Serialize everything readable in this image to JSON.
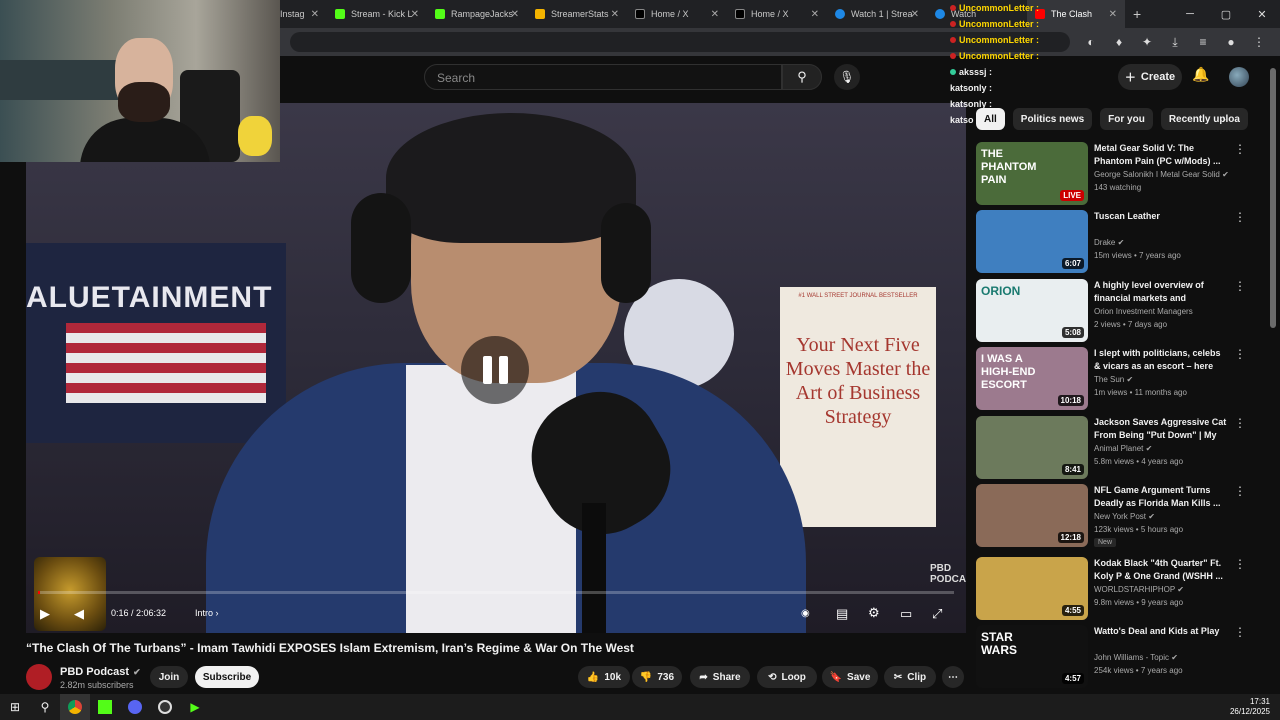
{
  "browser": {
    "tabs": [
      {
        "label": "Instag",
        "color": "#c13584"
      },
      {
        "label": "Stream - Kick L",
        "color": "#53fc18"
      },
      {
        "label": "RampageJacks",
        "color": "#53fc18"
      },
      {
        "label": "StreamerStats",
        "color": "#f4b400"
      },
      {
        "label": "Home / X",
        "color": "#ffffff"
      },
      {
        "label": "Home / X",
        "color": "#ffffff"
      },
      {
        "label": "Watch 1 | Strea",
        "color": "#1e88e5"
      },
      {
        "label": "Watch",
        "color": "#1e88e5"
      },
      {
        "label": "The Clash",
        "color": "#ff0000"
      }
    ],
    "close_glyph": "✕",
    "new_tab": "+",
    "win_min": "─",
    "win_max": "▢",
    "win_close": "✕"
  },
  "header": {
    "search_placeholder": "Search",
    "create_label": "Create"
  },
  "chat": [
    {
      "user": "UncommonLetter :",
      "color": "#ffd700"
    },
    {
      "user": "UncommonLetter :",
      "color": "#ffd700"
    },
    {
      "user": "UncommonLetter :",
      "color": "#ffd700"
    },
    {
      "user": "UncommonLetter :",
      "color": "#ffd700"
    },
    {
      "user": "aksssj :",
      "color": "#ffffff"
    },
    {
      "user": "katsonly :",
      "color": "#ffffff"
    },
    {
      "user": "katsonly :",
      "color": "#ffffff"
    },
    {
      "user": "katso",
      "color": "#ffffff"
    }
  ],
  "video": {
    "flag_text": "ALUETAINMENT",
    "book_top": "#1 WALL STREET JOURNAL BESTSELLER",
    "book_text": "Your Next Five Moves Master the Art of Business Strategy",
    "logo": "PBD PODCAST",
    "time": "0:16 / 2:06:32",
    "chapter": "Intro",
    "progress": 0.0021
  },
  "meta": {
    "title": "“The Clash Of The Turbans” - Imam Tawhidi EXPOSES Islam Extremism, Iran’s Regime & War On The West",
    "channel": "PBD Podcast",
    "subscribers": "2.82m subscribers",
    "join": "Join",
    "subscribe": "Subscribe",
    "likes": "10k",
    "dislikes": "736",
    "share": "Share",
    "loop": "Loop",
    "save": "Save",
    "clip": "Clip"
  },
  "sidebar": {
    "chips": [
      "All",
      "Politics news",
      "For you",
      "Recently uploa"
    ],
    "items": [
      {
        "title": "Metal Gear Solid V: The Phantom Pain (PC w/Mods) ...",
        "channel": "George Salonikh I Metal Gear Solid",
        "meta": "143 watching",
        "duration": "LIVE",
        "thumb_text": "THE PHANTOM PAIN",
        "thumb_bg": "#4b6b3a",
        "verified": true
      },
      {
        "title": "Tuscan Leather",
        "channel": "Drake",
        "meta": "15m views • 7 years ago",
        "duration": "6:07",
        "thumb_text": "",
        "thumb_bg": "#3f7fc0",
        "verified": true
      },
      {
        "title": "A highly level overview of financial markets and portfolio...",
        "channel": "Orion Investment Managers",
        "meta": "2 views • 7 days ago",
        "duration": "5:08",
        "thumb_text": "ORION",
        "thumb_bg": "#e9eef0",
        "verified": false
      },
      {
        "title": "I slept with politicians, celebs & vicars as an escort – here are ...",
        "channel": "The Sun",
        "meta": "1m views • 11 months ago",
        "duration": "10:18",
        "thumb_text": "I WAS A HIGH-END ESCORT",
        "thumb_bg": "#9c7a8e",
        "verified": true
      },
      {
        "title": "Jackson Saves Aggressive Cat From Being \"Put Down\" | My C...",
        "channel": "Animal Planet",
        "meta": "5.8m views • 4 years ago",
        "duration": "8:41",
        "thumb_text": "",
        "thumb_bg": "#6c7a5c",
        "verified": true
      },
      {
        "title": "NFL Game Argument Turns Deadly as Florida Man Kills ...",
        "channel": "New York Post",
        "meta": "123k views • 5 hours ago",
        "duration": "12:18",
        "thumb_text": "",
        "thumb_bg": "#8a6a58",
        "verified": true,
        "badge": "New"
      },
      {
        "title": "Kodak Black \"4th Quarter\" Ft. Koly P & One Grand (WSHH ...",
        "channel": "WORLDSTARHIPHOP",
        "meta": "9.8m views • 9 years ago",
        "duration": "4:55",
        "thumb_text": "",
        "thumb_bg": "#c9a44a",
        "verified": true
      },
      {
        "title": "Watto's Deal and Kids at Play",
        "channel": "John Williams - Topic",
        "meta": "254k views • 7 years ago",
        "duration": "4:57",
        "thumb_text": "STAR WARS",
        "thumb_bg": "#111111",
        "verified": true
      }
    ]
  },
  "taskbar": {
    "time": "17:31",
    "date": "26/12/2025"
  }
}
